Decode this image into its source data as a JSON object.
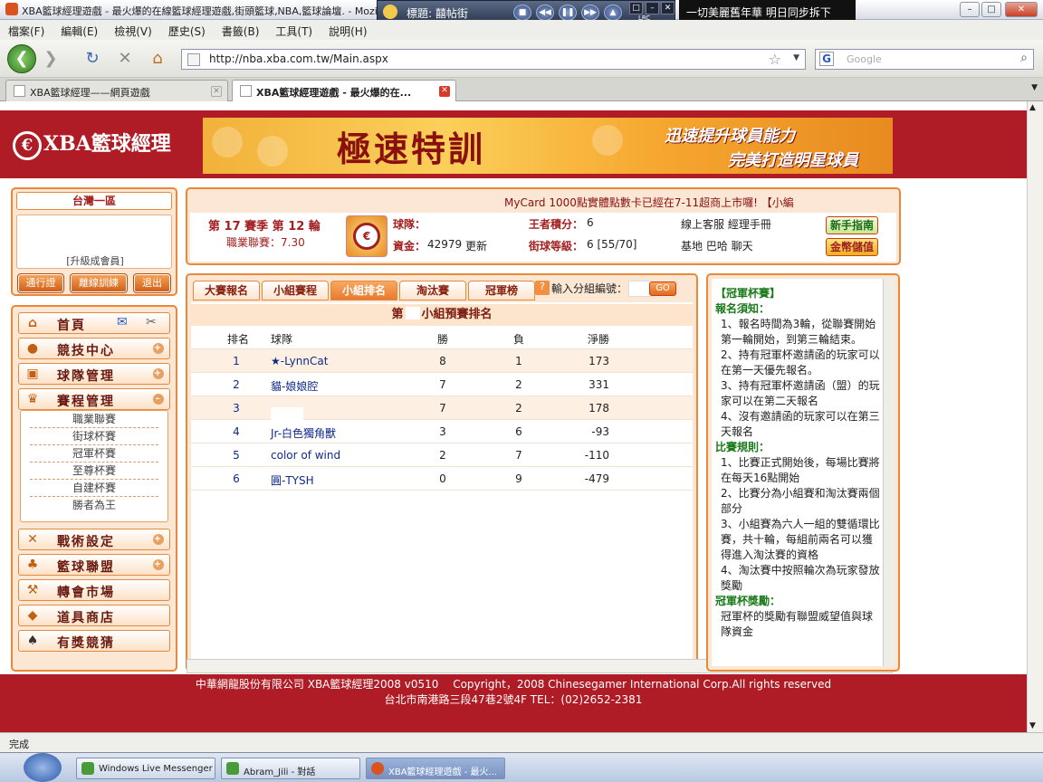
{
  "window": {
    "title": "XBA籃球經理遊戲 - 最火爆的在線籃球經理遊戲,街頭籃球,NBA,籃球論壇. - Mozilla Firefox"
  },
  "player": {
    "title": "標題: 囍帖街",
    "lrc": "LRC",
    "lyric": "一切美麗舊年華 明日同步拆下"
  },
  "menu": [
    "檔案(F)",
    "編輯(E)",
    "檢視(V)",
    "歷史(S)",
    "書籤(B)",
    "工具(T)",
    "說明(H)"
  ],
  "nav": {
    "url": "http://nba.xba.com.tw/Main.aspx",
    "search_placeholder": "Google"
  },
  "tabs": [
    "XBA籃球經理——網頁遊戲",
    "XBA籃球經理遊戲 - 最火爆的在..."
  ],
  "site": {
    "logo": "XBA籃球經理",
    "banner_title": "極速特訓",
    "banner_line1": "迅速提升球員能力",
    "banner_line2": "完美打造明星球員"
  },
  "left": {
    "region": "台灣一區",
    "upgrade": "[升級成會員]",
    "btn_pass": "通行證",
    "btn_offline": "離線訓練",
    "btn_exit": "退出",
    "menu": [
      {
        "label": "首頁",
        "icon": "home-icon"
      },
      {
        "label": "競技中心",
        "icon": "basketball-icon"
      },
      {
        "label": "球隊管理",
        "icon": "team-icon"
      },
      {
        "label": "賽程管理",
        "icon": "trophy-icon"
      },
      {
        "label": "戰術設定",
        "icon": "tactics-icon"
      },
      {
        "label": "籃球聯盟",
        "icon": "league-icon"
      },
      {
        "label": "轉會市場",
        "icon": "hammer-icon"
      },
      {
        "label": "道具商店",
        "icon": "gold-icon"
      },
      {
        "label": "有獎競猜",
        "icon": "spade-icon"
      }
    ],
    "submenu": [
      "職業聯賽",
      "街球杯賽",
      "冠軍杯賽",
      "至尊杯賽",
      "自建杯賽",
      "勝者為王"
    ]
  },
  "info": {
    "marquee": "MyCard 1000點實體點數卡已經在7-11超商上市囉! 【小編",
    "season": "第 17 賽季 第 12 輪",
    "league": "職業聯賽：7.30",
    "team_label": "球隊：",
    "funds_label": "資金：",
    "funds": "42979",
    "refresh": "更新",
    "king_label": "王者積分：",
    "king": "6",
    "street_label": "街球等級：",
    "street": "6 [55/70]",
    "service": "線上客服 經理手冊",
    "base": "基地 巴哈 聊天",
    "btn_guide": "新手指南",
    "btn_deposit": "金幣儲值"
  },
  "main": {
    "tabs": [
      "大賽報名",
      "小組賽程",
      "小組排名",
      "淘汰賽",
      "冠軍榜"
    ],
    "input_label": "輸入分組編號：",
    "go": "GO",
    "group_title_pre": "第",
    "group_title_post": "小組預賽排名",
    "headers": [
      "排名",
      "球隊",
      "勝",
      "負",
      "淨勝"
    ],
    "rows": [
      [
        "1",
        "★-LynnCat",
        "8",
        "1",
        "173"
      ],
      [
        "2",
        "貓-娘娘腔",
        "7",
        "2",
        "331"
      ],
      [
        "3",
        "",
        "7",
        "2",
        "178"
      ],
      [
        "4",
        "Jr-白色獨角獸",
        "3",
        "6",
        "-93"
      ],
      [
        "5",
        "color of wind",
        "2",
        "7",
        "-110"
      ],
      [
        "6",
        "圓-TYSH",
        "0",
        "9",
        "-479"
      ]
    ]
  },
  "right": {
    "title": "【冠軍杯賽】",
    "reg_head": "報名須知：",
    "reg": [
      "1、報名時間為3輪，從聯賽開始第一輪開始，到第三輪結束。",
      "2、持有冠軍杯邀請函的玩家可以在第一天優先報名。",
      "3、持有冠軍杯邀請函（盟）的玩家可以在第二天報名",
      "4、沒有邀請函的玩家可以在第三天報名"
    ],
    "rule_head": "比賽規則：",
    "rules": [
      "1、比賽正式開始後，每場比賽將在每天16點開始",
      "2、比賽分為小組賽和淘汰賽兩個部分",
      "3、小組賽為六人一組的雙循環比賽，共十輪，每組前兩名可以獲得進入淘汰賽的資格",
      "4、淘汰賽中按照輪次為玩家發放獎勵"
    ],
    "prize_head": "冠軍杯獎勵：",
    "prize": "冠軍杯的獎勵有聯盟威望值與球隊資金"
  },
  "footer": {
    "line1": "中華網龍股份有限公司 XBA籃球經理2008 v0510 　Copyright，2008 Chinesegamer International Corp.All rights reserved",
    "line2": "台北市南港路三段47巷2號4F TEL：(02)2652-2381"
  },
  "status": "完成",
  "taskbar": [
    "Windows Live Messenger",
    "Abram_Jili - 對話",
    "XBA籃球經理遊戲 - 最火..."
  ]
}
